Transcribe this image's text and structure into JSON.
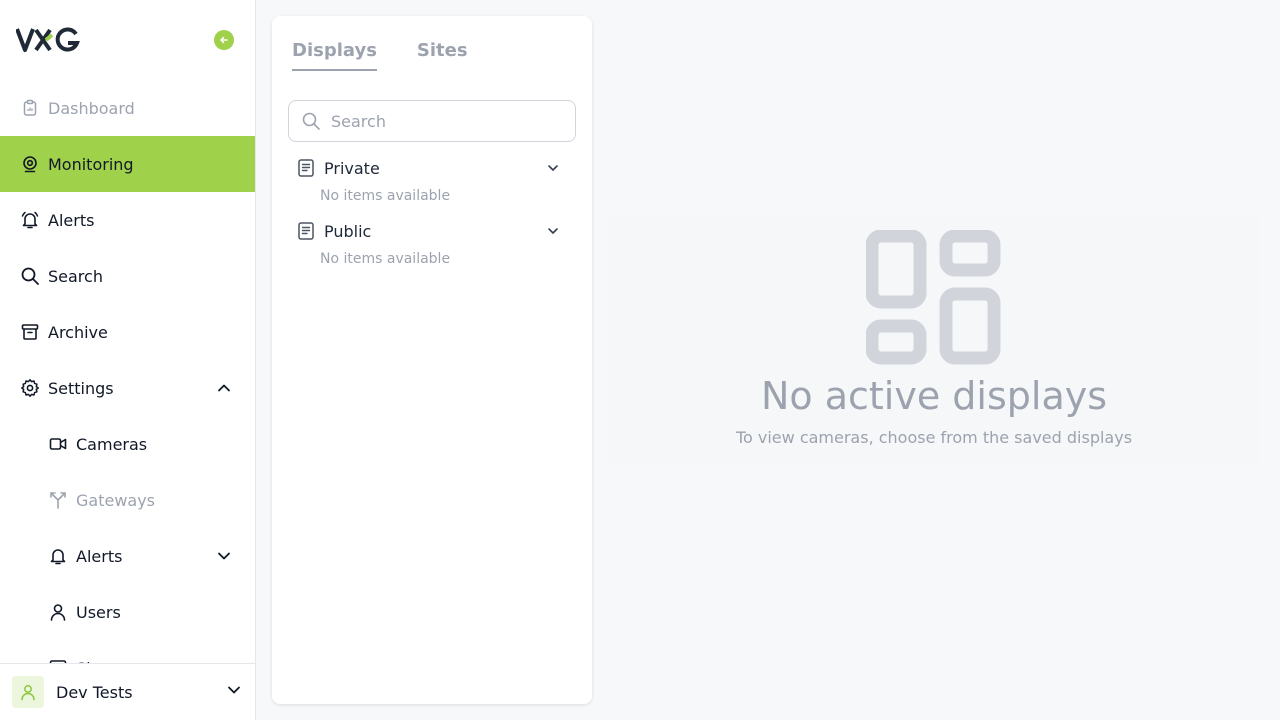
{
  "brand": {
    "logo_text": "VXG",
    "accent": "#a0d14b"
  },
  "sidebar": {
    "items": [
      {
        "label": "Dashboard",
        "icon": "clipboard-icon",
        "state": "disabled"
      },
      {
        "label": "Monitoring",
        "icon": "webcam-icon",
        "state": "active"
      },
      {
        "label": "Alerts",
        "icon": "bell-alert-icon",
        "state": "normal"
      },
      {
        "label": "Search",
        "icon": "search-icon",
        "state": "normal"
      },
      {
        "label": "Archive",
        "icon": "archive-icon",
        "state": "normal"
      },
      {
        "label": "Settings",
        "icon": "gear-icon",
        "state": "normal",
        "expanded": true
      }
    ],
    "sub_items": [
      {
        "label": "Cameras",
        "icon": "video-camera-icon",
        "state": "normal"
      },
      {
        "label": "Gateways",
        "icon": "gateway-icon",
        "state": "disabled"
      },
      {
        "label": "Alerts",
        "icon": "bell-icon",
        "state": "normal",
        "expandable": true
      },
      {
        "label": "Users",
        "icon": "user-icon",
        "state": "normal"
      },
      {
        "label": "Si",
        "icon": "sites-icon",
        "state": "normal"
      }
    ],
    "footer": {
      "name": "Dev Tests",
      "icon": "user-icon"
    }
  },
  "panel": {
    "tabs": [
      {
        "label": "Displays",
        "active": true
      },
      {
        "label": "Sites",
        "active": false
      }
    ],
    "search": {
      "placeholder": "Search",
      "value": ""
    },
    "groups": [
      {
        "label": "Private",
        "empty_text": "No items available"
      },
      {
        "label": "Public",
        "empty_text": "No items available"
      }
    ]
  },
  "main": {
    "empty_title": "No active displays",
    "empty_subtitle": "To view cameras, choose from the saved displays",
    "icon": "dashboard-layout-icon"
  }
}
